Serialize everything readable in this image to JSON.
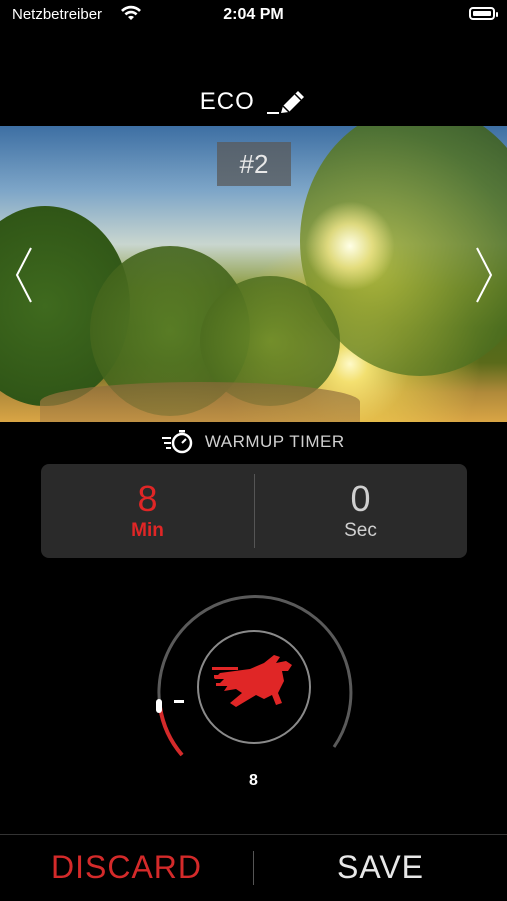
{
  "status_bar": {
    "carrier": "Netzbetreiber",
    "time": "2:04 PM"
  },
  "header": {
    "mode_title": "ECO",
    "edit_icon": "pencil-icon"
  },
  "hero": {
    "preset_badge": "#2",
    "prev_icon": "chevron-left-icon",
    "next_icon": "chevron-right-icon"
  },
  "warmup": {
    "label": "WARMUP TIMER",
    "icon": "stopwatch-icon",
    "minutes": {
      "value": "8",
      "unit": "Min"
    },
    "seconds": {
      "value": "0",
      "unit": "Sec"
    }
  },
  "dial": {
    "value": "8",
    "logo": "red-horse-logo"
  },
  "actions": {
    "discard_label": "DISCARD",
    "save_label": "SAVE"
  },
  "colors": {
    "accent_red": "#e02626",
    "background": "#000000",
    "panel": "#2a2a2a"
  }
}
